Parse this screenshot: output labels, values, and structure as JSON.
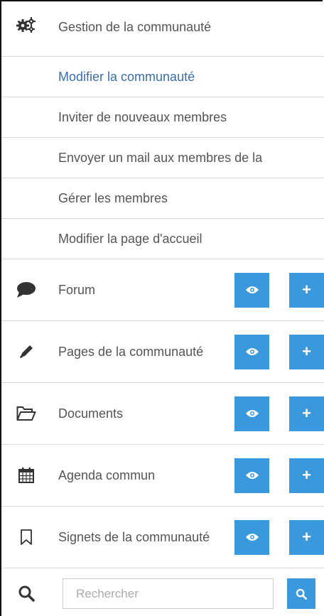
{
  "header": {
    "icon": "gears-icon",
    "title": "Gestion de la communauté"
  },
  "management": {
    "items": [
      {
        "label": "Modifier la communauté",
        "active": true
      },
      {
        "label": "Inviter de nouveaux membres"
      },
      {
        "label": "Envoyer un mail aux membres de la"
      },
      {
        "label": "Gérer les membres"
      },
      {
        "label": "Modifier la page d'accueil"
      }
    ]
  },
  "tools": [
    {
      "label": "Forum",
      "icon": "comment-icon"
    },
    {
      "label": "Pages de la communauté",
      "icon": "pencil-icon"
    },
    {
      "label": "Documents",
      "icon": "folder-open-icon"
    },
    {
      "label": "Agenda commun",
      "icon": "calendar-icon"
    },
    {
      "label": "Signets de la communauté",
      "icon": "bookmark-icon"
    }
  ],
  "search": {
    "placeholder": "Rechercher",
    "icon": "search-icon"
  },
  "colors": {
    "accent": "#3a98dc",
    "link": "#3a6fa8",
    "text": "#555555",
    "divider": "#d8d8d8"
  }
}
